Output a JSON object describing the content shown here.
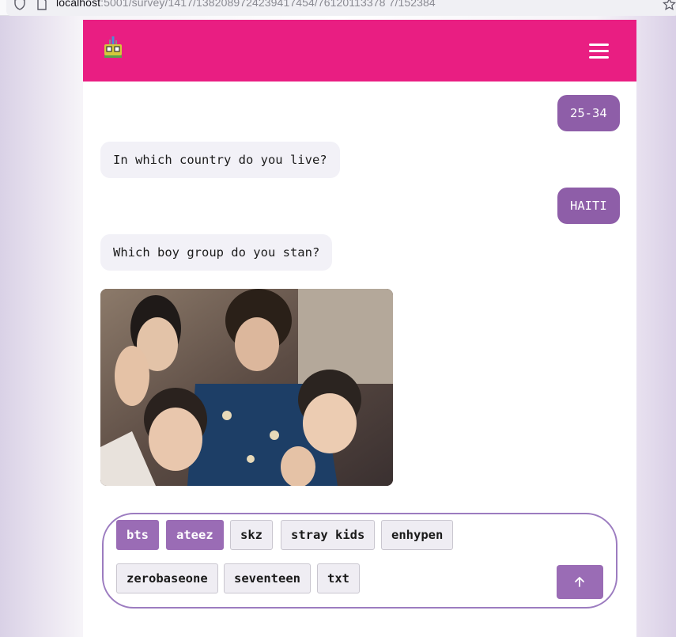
{
  "browser": {
    "url_host": "localhost",
    "url_path": ":5001/survey/1417/1382089724239417454/76120113378 7/152384",
    "icons": [
      "shield-icon",
      "page-icon",
      "star-icon"
    ]
  },
  "header": {
    "brand_color": "#e91e82",
    "icons": [
      "logo-icon",
      "hamburger-menu-icon"
    ]
  },
  "chat": {
    "user_msg_age": "25-34",
    "bot_msg_country": "In which country do you live?",
    "user_msg_country": "HAITI",
    "bot_msg_group": "Which boy group do you stan?"
  },
  "options": [
    {
      "label": "bts",
      "selected": true
    },
    {
      "label": "ateez",
      "selected": true
    },
    {
      "label": "skz",
      "selected": false
    },
    {
      "label": "stray kids",
      "selected": false
    },
    {
      "label": "enhypen",
      "selected": false
    },
    {
      "label": "zerobaseone",
      "selected": false
    },
    {
      "label": "seventeen",
      "selected": false
    },
    {
      "label": "txt",
      "selected": false
    }
  ],
  "composer": {
    "send_icon": "arrow-up-icon",
    "accent_color": "#9a6cb5"
  }
}
